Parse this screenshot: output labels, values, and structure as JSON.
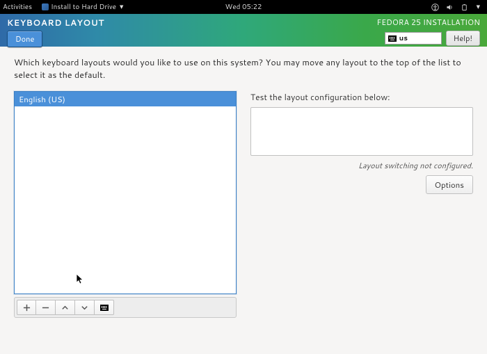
{
  "topbar": {
    "activities": "Activities",
    "app_name": "Install to Hard Drive",
    "clock": "Wed 05:22"
  },
  "header": {
    "title": "KEYBOARD LAYOUT",
    "done": "Done",
    "product": "FEDORA 25 INSTALLATION",
    "locale_code": "us",
    "help": "Help!"
  },
  "body": {
    "instructions": "Which keyboard layouts would you like to use on this system?  You may move any layout to the top of the list to select it as the default.",
    "layouts": [
      {
        "label": "English (US)"
      }
    ],
    "test_label": "Test the layout configuration below:",
    "switch_note": "Layout switching not configured.",
    "options": "Options"
  },
  "toolbar_icons": {
    "add": "plus-icon",
    "remove": "minus-icon",
    "up": "chevron-up-icon",
    "down": "chevron-down-icon",
    "preview": "keyboard-icon"
  }
}
